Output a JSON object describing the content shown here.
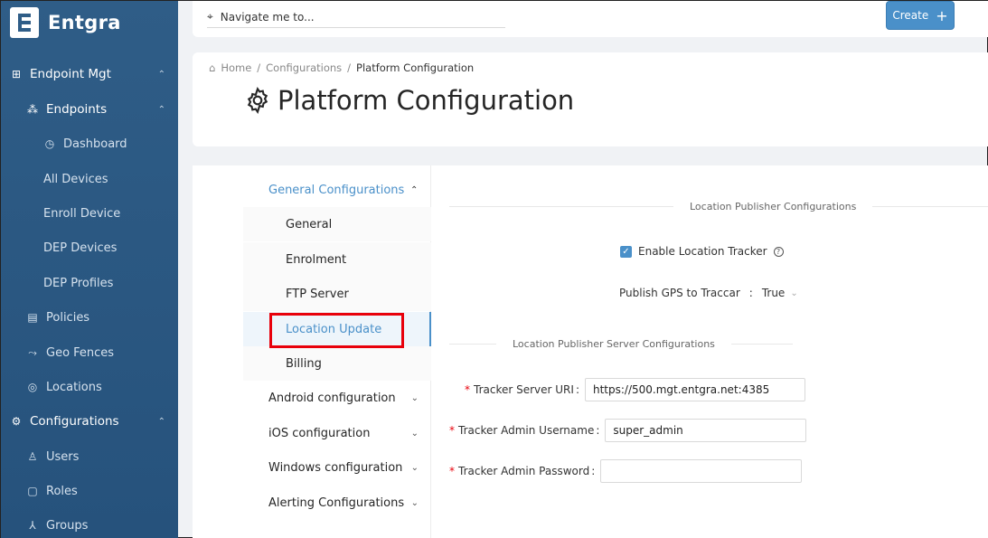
{
  "brand": {
    "name": "Entgra"
  },
  "sidebar": {
    "items": [
      {
        "label": "Endpoint Mgt",
        "icon": "grid-icon"
      },
      {
        "label": "Endpoints",
        "icon": "hierarchy-icon"
      },
      {
        "label": "Dashboard",
        "icon": "dashboard-icon"
      },
      {
        "label": "All Devices"
      },
      {
        "label": "Enroll Device"
      },
      {
        "label": "DEP Devices"
      },
      {
        "label": "DEP Profiles"
      },
      {
        "label": "Policies",
        "icon": "policy-icon"
      },
      {
        "label": "Geo Fences",
        "icon": "route-icon"
      },
      {
        "label": "Locations",
        "icon": "location-icon"
      },
      {
        "label": "Configurations",
        "icon": "gear-icon"
      },
      {
        "label": "Users",
        "icon": "user-icon"
      },
      {
        "label": "Roles",
        "icon": "roles-icon"
      },
      {
        "label": "Groups",
        "icon": "groups-icon"
      }
    ]
  },
  "topbar": {
    "search_placeholder": "Navigate me to...",
    "create_label": "Create"
  },
  "breadcrumb": {
    "home": "Home",
    "configurations": "Configurations",
    "current": "Platform Configuration"
  },
  "page": {
    "title": "Platform Configuration"
  },
  "submenu": {
    "general": "General Configurations",
    "general_items": [
      "General",
      "Enrolment",
      "FTP Server",
      "Location Update",
      "Billing"
    ],
    "android": "Android configuration",
    "ios": "iOS configuration",
    "windows": "Windows configuration",
    "alerting": "Alerting Configurations"
  },
  "form": {
    "section1": "Location Publisher Configurations",
    "enable_tracker_label": "Enable Location Tracker",
    "enable_tracker_checked": true,
    "gps_label": "Publish GPS to Traccar",
    "gps_value": "True",
    "section2": "Location Publisher Server Configurations",
    "server_uri_label": "Tracker Server URI",
    "server_uri_value": "https://500.mgt.entgra.net:4385",
    "admin_user_label": "Tracker Admin Username",
    "admin_user_value": "super_admin",
    "admin_pass_label": "Tracker Admin Password",
    "admin_pass_value": ""
  },
  "colors": {
    "sidebar": "#2f5d87",
    "accent": "#4a90c9",
    "highlight": "#e8000b"
  }
}
